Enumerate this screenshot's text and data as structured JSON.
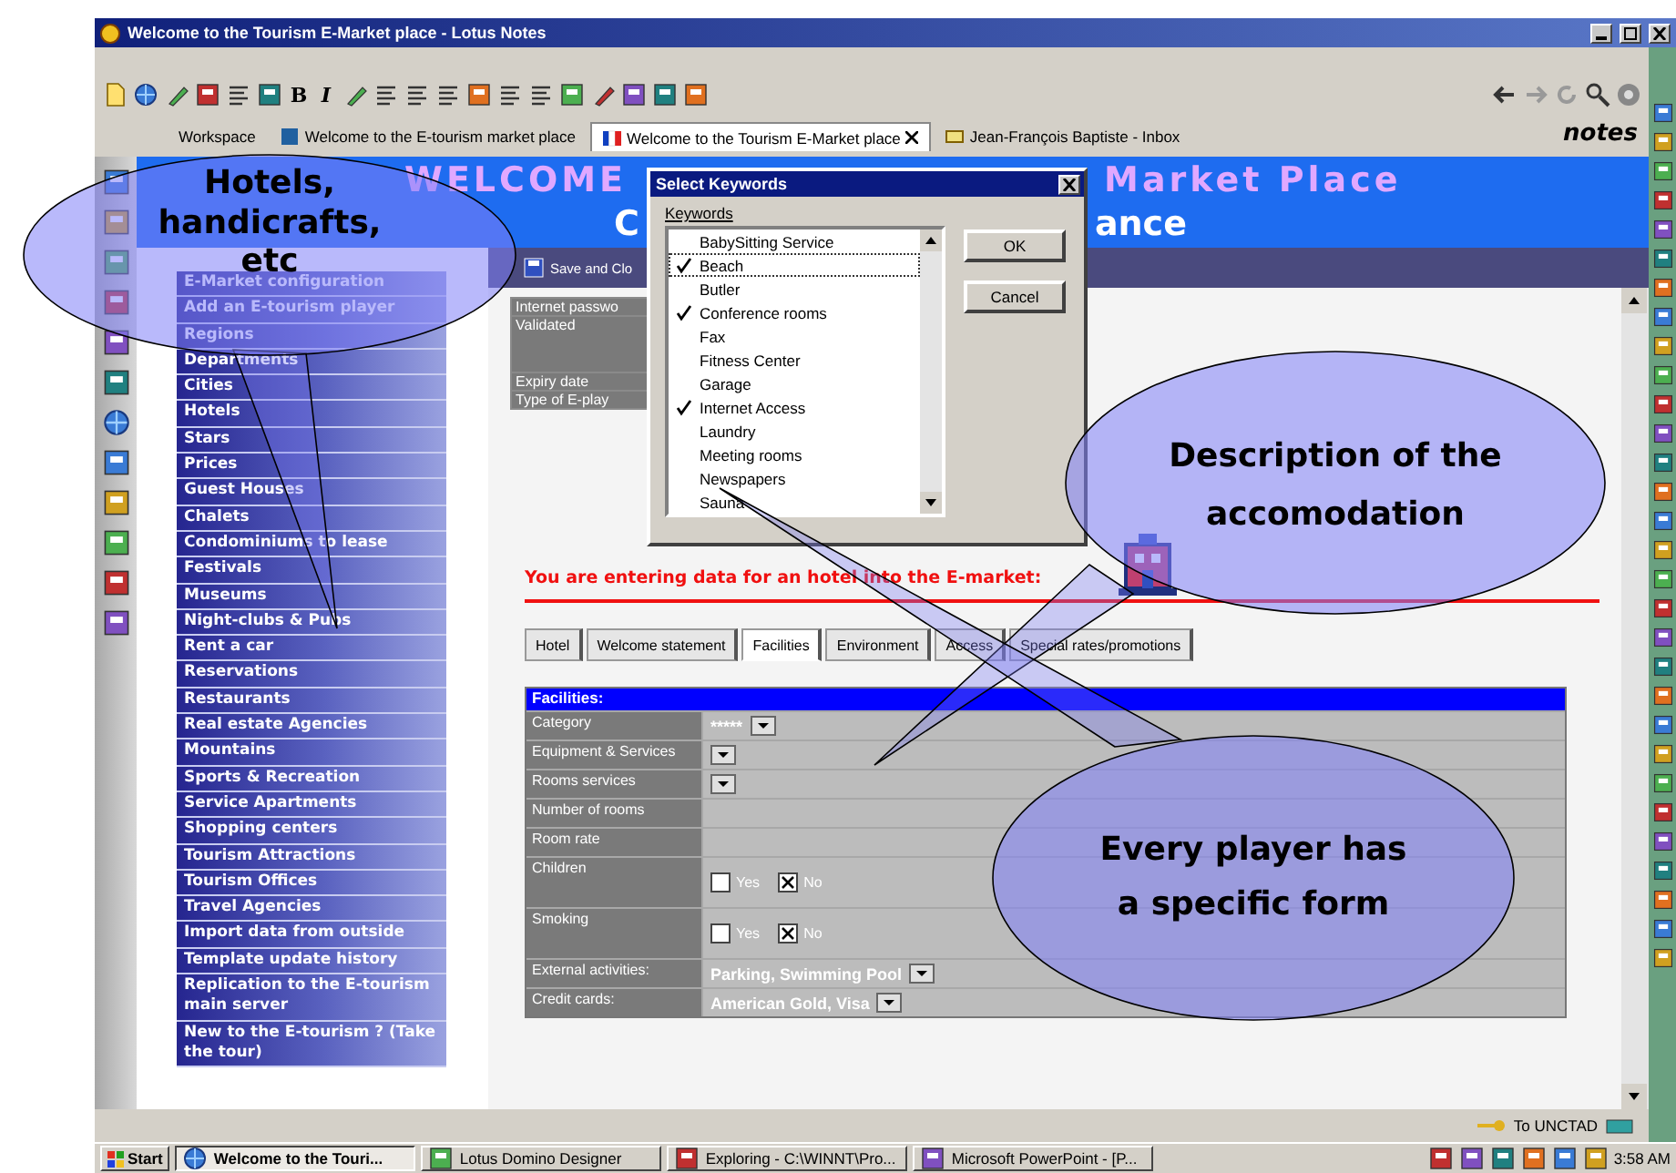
{
  "window": {
    "title": "Welcome to the Tourism E-Market place - Lotus Notes"
  },
  "toolbar": {
    "format_buttons": [
      "B",
      "I"
    ]
  },
  "tabs": [
    {
      "label": "Workspace",
      "selected": false
    },
    {
      "label": "Welcome to the E-tourism market place",
      "selected": false
    },
    {
      "label": "Welcome to the Tourism E-Market place",
      "selected": true
    },
    {
      "label": "Jean-François Baptiste - Inbox",
      "selected": false
    }
  ],
  "logo": "notes",
  "banner": {
    "title_left": "WELCOME",
    "title_right": "Market Place",
    "subtitle_left": "C",
    "subtitle_right": "ance"
  },
  "action_bar": {
    "button": "Save and Clo"
  },
  "sidebar": {
    "items": [
      "E-Market configuration",
      "Add an E-tourism player",
      "Regions",
      "Departments",
      "Cities",
      "Hotels",
      "Stars",
      "Prices",
      "Guest Houses",
      "Chalets",
      "Condominiums to lease",
      "Festivals",
      "Museums",
      "Night-clubs & Pubs",
      "Rent a car",
      "Reservations",
      "Restaurants",
      "Real estate Agencies",
      "Mountains",
      "Sports & Recreation",
      "Service Apartments",
      "Shopping centers",
      "Tourism Attractions",
      "Tourism Offices",
      "Travel Agencies",
      "Import data from outside",
      "Template update history",
      "Replication to the E-tourism main server",
      "New to the E-tourism ? (Take the tour)"
    ]
  },
  "summary_fields": [
    "Internet passwo",
    "Validated",
    "Expiry date",
    "Type of E-play"
  ],
  "notice": "You are entering data for an hotel into the E-market:",
  "form_tabs": [
    {
      "label": "Hotel",
      "selected": false
    },
    {
      "label": "Welcome statement",
      "selected": false
    },
    {
      "label": "Facilities",
      "selected": true
    },
    {
      "label": "Environment",
      "selected": false
    },
    {
      "label": "Access",
      "selected": false
    },
    {
      "label": "Special rates/promotions",
      "selected": false
    }
  ],
  "form": {
    "header": "Facilities:",
    "rows": [
      {
        "kind": "dropdown",
        "label": "Category",
        "value": "*****"
      },
      {
        "kind": "dropdown",
        "label": "Equipment & Services"
      },
      {
        "kind": "dropdown",
        "label": "Rooms services"
      },
      {
        "kind": "text",
        "label": "Number of rooms"
      },
      {
        "kind": "text",
        "label": "Room rate"
      },
      {
        "kind": "choice",
        "label": "Children",
        "options": [
          {
            "label": "Yes",
            "checked": false
          },
          {
            "label": "No",
            "checked": true
          }
        ]
      },
      {
        "kind": "choice",
        "label": "Smoking",
        "options": [
          {
            "label": "Yes",
            "checked": false
          },
          {
            "label": "No",
            "checked": true
          }
        ]
      },
      {
        "kind": "dropdown",
        "label": "External activities:",
        "value": "Parking, Swimming Pool"
      },
      {
        "kind": "dropdown",
        "label": "Credit cards:",
        "value": "American Gold, Visa"
      }
    ]
  },
  "status_bar": {
    "location": "To UNCTAD"
  },
  "taskbar": {
    "start": "Start",
    "tasks": [
      {
        "label": "Welcome to the Touri...",
        "selected": true
      },
      {
        "label": "Lotus Domino Designer",
        "selected": false
      },
      {
        "label": "Exploring - C:\\WINNT\\Pro...",
        "selected": false
      },
      {
        "label": "Microsoft PowerPoint - [P...",
        "selected": false
      }
    ],
    "clock": "3:58 AM"
  },
  "dialog": {
    "title": "Select Keywords",
    "list_label": "Keywords",
    "items": [
      {
        "label": "BabySitting Service",
        "checked": false,
        "selected": false
      },
      {
        "label": "Beach",
        "checked": true,
        "selected": true
      },
      {
        "label": "Butler",
        "checked": false,
        "selected": false
      },
      {
        "label": "Conference rooms",
        "checked": true,
        "selected": false
      },
      {
        "label": "Fax",
        "checked": false,
        "selected": false
      },
      {
        "label": "Fitness Center",
        "checked": false,
        "selected": false
      },
      {
        "label": "Garage",
        "checked": false,
        "selected": false
      },
      {
        "label": "Internet Access",
        "checked": true,
        "selected": false
      },
      {
        "label": "Laundry",
        "checked": false,
        "selected": false
      },
      {
        "label": "Meeting rooms",
        "checked": false,
        "selected": false
      },
      {
        "label": "Newspapers",
        "checked": false,
        "selected": false
      },
      {
        "label": "Sauna",
        "checked": false,
        "selected": false
      }
    ],
    "buttons": [
      "OK",
      "Cancel"
    ]
  },
  "callouts": [
    {
      "lines": [
        "Hotels,",
        "handicrafts,",
        "etc"
      ]
    },
    {
      "lines": [
        "Description of the",
        "accomodation"
      ]
    },
    {
      "lines": [
        "Every player has",
        "a specific form"
      ]
    }
  ]
}
